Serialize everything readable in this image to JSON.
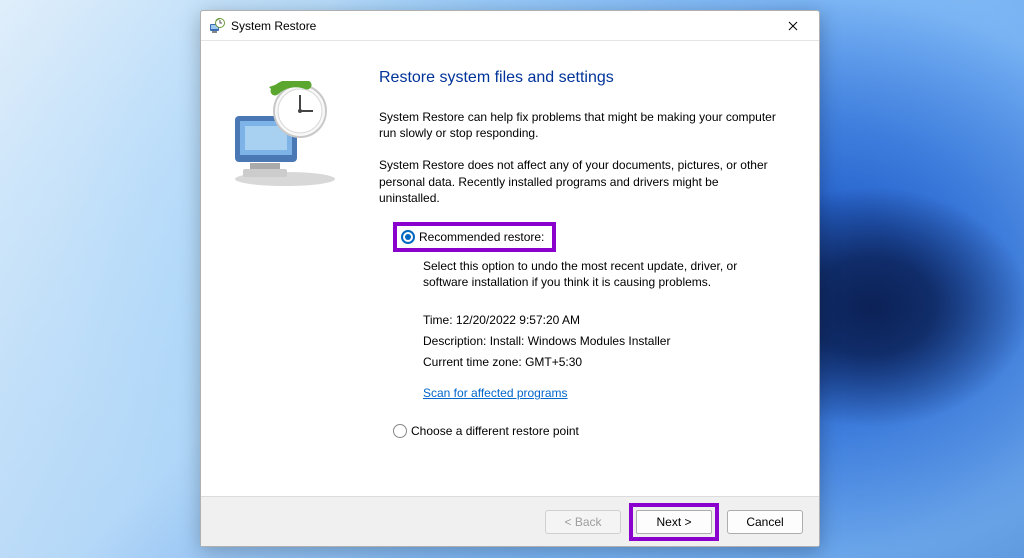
{
  "window": {
    "title": "System Restore"
  },
  "content": {
    "heading": "Restore system files and settings",
    "intro": "System Restore can help fix problems that might be making your computer run slowly or stop responding.",
    "info": "System Restore does not affect any of your documents, pictures, or other personal data. Recently installed programs and drivers might be uninstalled."
  },
  "options": {
    "recommended": {
      "label": "Recommended restore:",
      "desc": "Select this option to undo the most recent update, driver, or software installation if you think it is causing problems.",
      "selected": true
    },
    "different": {
      "label": "Choose a different restore point",
      "selected": false
    }
  },
  "details": {
    "time_label": "Time:",
    "time_value": "12/20/2022 9:57:20 AM",
    "desc_label": "Description:",
    "desc_value": "Install: Windows Modules Installer",
    "tz_label": "Current time zone:",
    "tz_value": "GMT+5:30",
    "scan_link": "Scan for affected programs"
  },
  "footer": {
    "back": "< Back",
    "next": "Next >",
    "cancel": "Cancel"
  },
  "highlight_color": "#8a00cc"
}
